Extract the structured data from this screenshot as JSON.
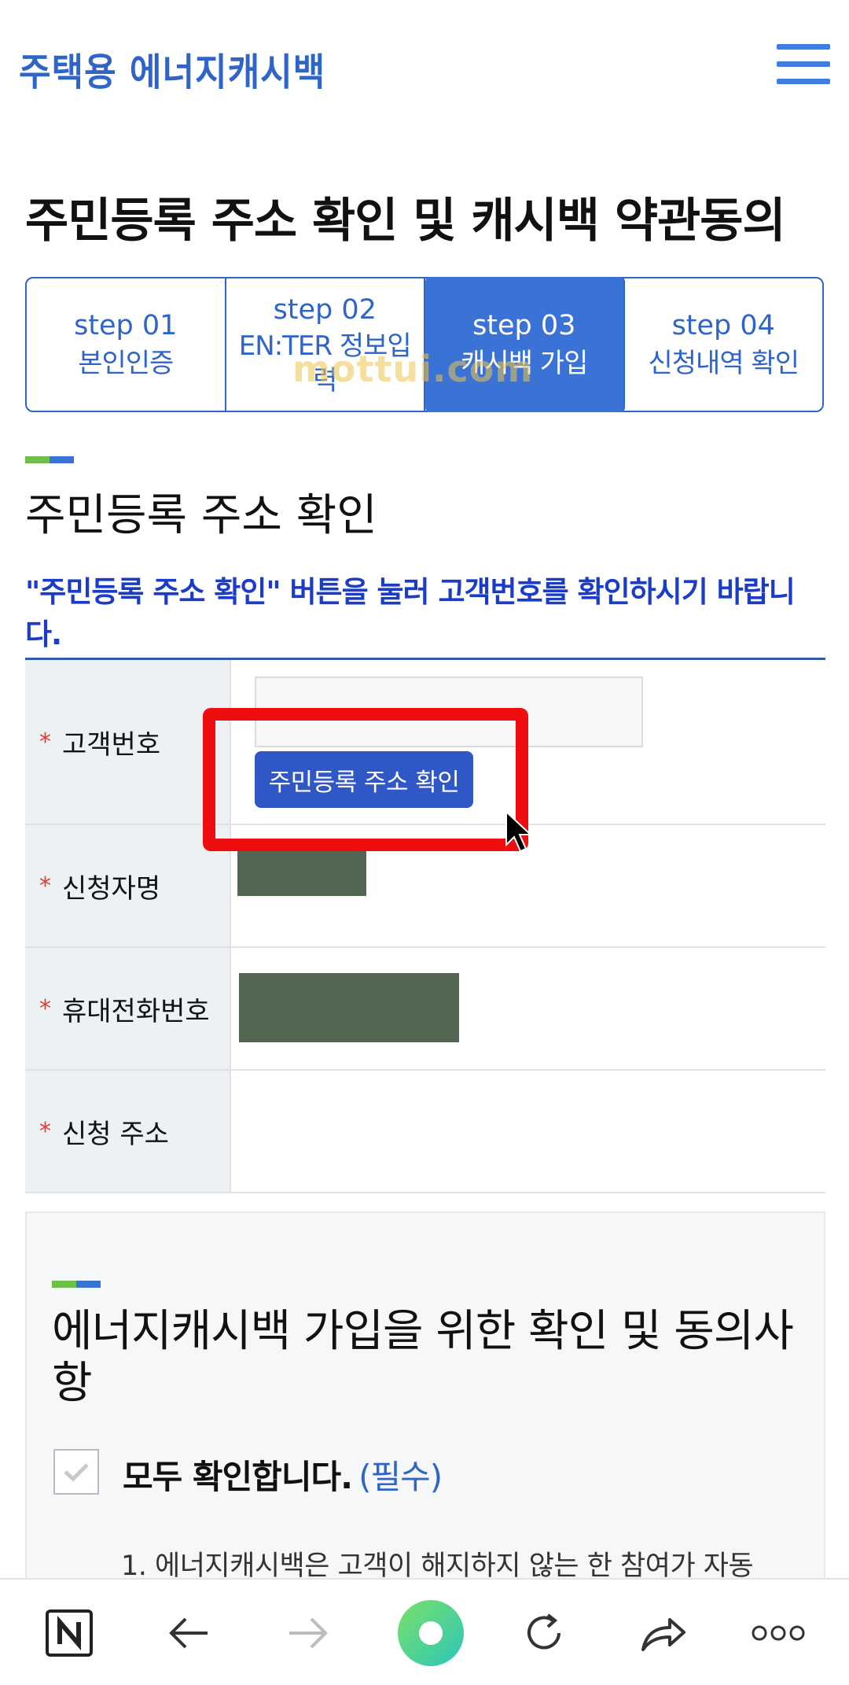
{
  "header": {
    "logo": "주택용 에너지캐시백"
  },
  "page_title": "주민등록 주소 확인 및 캐시백 약관동의",
  "steps": [
    {
      "num": "step 01",
      "label": "본인인증",
      "active": false
    },
    {
      "num": "step 02",
      "label": "EN:TER 정보입력",
      "active": false
    },
    {
      "num": "step 03",
      "label": "캐시백 가입",
      "active": true
    },
    {
      "num": "step 04",
      "label": "신청내역 확인",
      "active": false
    }
  ],
  "watermark": "mottui.com",
  "section1": {
    "title": "주민등록 주소 확인",
    "notice": "\"주민등록 주소 확인\" 버튼을 눌러 고객번호를 확인하시기 바랍니다."
  },
  "form": {
    "required_mark": "*",
    "rows": [
      {
        "label": "고객번호"
      },
      {
        "label": "신청자명"
      },
      {
        "label": "휴대전화번호"
      },
      {
        "label": "신청 주소"
      }
    ],
    "verify_button": "주민등록 주소 확인"
  },
  "terms": {
    "title": "에너지캐시백 가입을 위한 확인 및 동의사항",
    "all_agree": "모두 확인합니다.",
    "all_agree_required": "(필수)",
    "item1": "1. 에너지캐시백은 고객이 해지하지 않는 한 참여가 자동"
  },
  "colors": {
    "brand_blue": "#2f64c9",
    "active_step": "#3a72d6",
    "notice_blue": "#1a3cc7",
    "highlight_red": "#ee0e10",
    "redaction": "#526652"
  },
  "bottom_bar": {
    "icons": [
      "n-home-icon",
      "back-arrow-icon",
      "forward-arrow-icon",
      "green-orb-icon",
      "refresh-icon",
      "share-icon",
      "more-dots-icon"
    ]
  }
}
